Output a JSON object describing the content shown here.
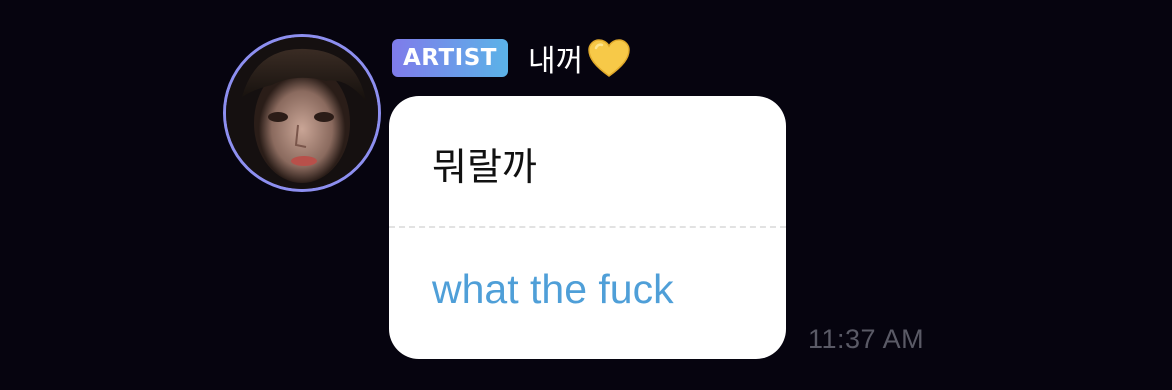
{
  "message": {
    "sender": {
      "badge": "ARTIST",
      "name": "내꺼",
      "name_emoji": "yellow-heart-icon",
      "avatar_border_color": "#8d8ff0"
    },
    "original_text": "뭐랄까",
    "translated_text": "what the fuck",
    "timestamp": "11:37 AM"
  },
  "colors": {
    "background": "#06040f",
    "badge_gradient_start": "#7f7bea",
    "badge_gradient_end": "#5bb3e8",
    "translation_text": "#4f9fd8",
    "timestamp_text": "#5a5a66",
    "bubble": "#ffffff"
  }
}
